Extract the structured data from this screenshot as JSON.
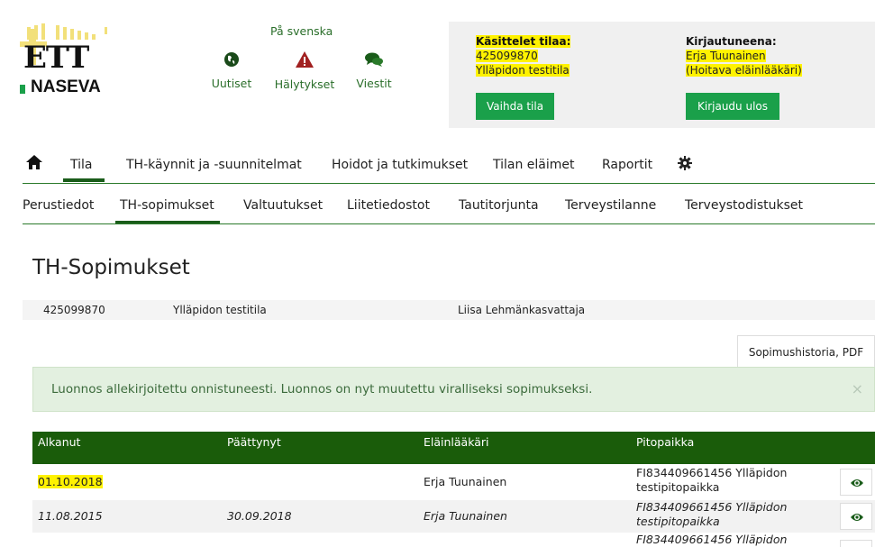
{
  "header": {
    "logo_text_top": "ETT",
    "logo_text_bottom": "NASEVA",
    "language_link": "På svenska",
    "nav": [
      {
        "label": "Uutiset",
        "icon": "globe-icon"
      },
      {
        "label": "Hälytykset",
        "icon": "warning-icon"
      },
      {
        "label": "Viestit",
        "icon": "chat-icon"
      }
    ]
  },
  "status_panel": {
    "handling_label": "Käsittelet tilaa:",
    "farm_id": "425099870",
    "farm_name": "Ylläpidon testitila",
    "change_farm_button": "Vaihda tila",
    "logged_in_label": "Kirjautuneena:",
    "user_name": "Erja Tuunainen",
    "user_role": "(Hoitava eläinlääkäri)",
    "logout_button": "Kirjaudu ulos"
  },
  "main_nav": {
    "items": [
      "Tila",
      "TH-käynnit ja -suunnitelmat",
      "Hoidot ja tutkimukset",
      "Tilan eläimet",
      "Raportit"
    ],
    "active": "Tila"
  },
  "sub_nav": {
    "items": [
      "Perustiedot",
      "TH-sopimukset",
      "Valtuutukset",
      "Liitetiedostot",
      "Tautitorjunta",
      "Terveystilanne",
      "Terveystodistukset"
    ],
    "active": "TH-sopimukset"
  },
  "page": {
    "title": "TH-Sopimukset",
    "info": {
      "farm_id": "425099870",
      "farm_name": "Ylläpidon testitila",
      "owner": "Liisa Lehmänkasvattaja"
    },
    "pdf_button": "Sopimushistoria, PDF",
    "alert": {
      "text": "Luonnos allekirjoitettu onnistuneesti. Luonnos on nyt muutettu viralliseksi sopimukseksi.",
      "close": "×"
    }
  },
  "table": {
    "headers": [
      "Alkanut",
      "Päättynyt",
      "Eläinlääkäri",
      "Pitopaikka"
    ],
    "rows": [
      {
        "alkanut": "01.10.2018",
        "paattynyt": "",
        "vet": "Erja Tuunainen",
        "pito1": "FI834409661456 Ylläpidon",
        "pito2": "testipitopaikka",
        "italic": false
      },
      {
        "alkanut": "11.08.2015",
        "paattynyt": "30.09.2018",
        "vet": "Erja Tuunainen",
        "pito1": "FI834409661456 Ylläpidon",
        "pito2": "testipitopaikka",
        "italic": true
      },
      {
        "alkanut": "",
        "paattynyt": "",
        "vet": "",
        "pito1": "FI834409661456 Ylläpidon",
        "pito2": "",
        "italic": true
      }
    ]
  },
  "colors": {
    "brand_green": "#1aa04a",
    "dark_green": "#1a5c0a",
    "highlight": "#fff200",
    "alert_bg": "#e3f0e0"
  }
}
